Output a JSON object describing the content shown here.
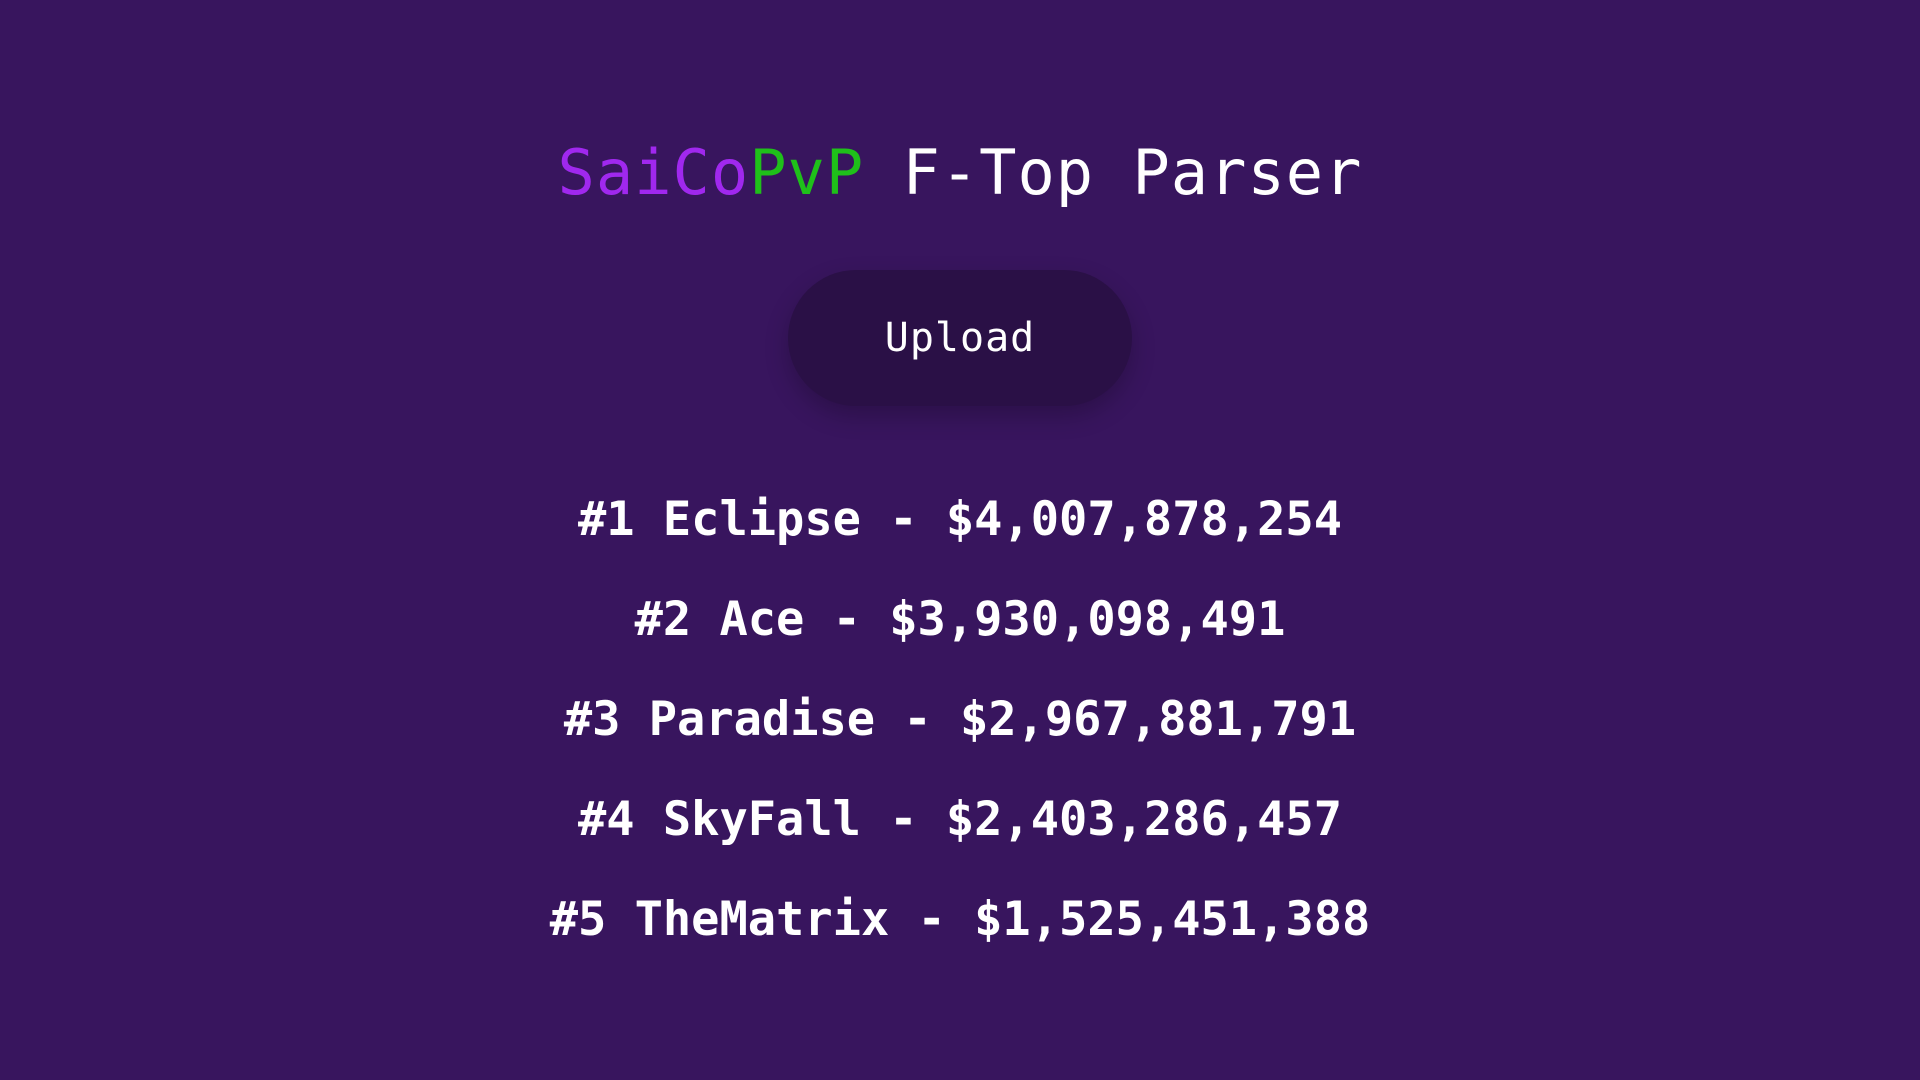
{
  "title": {
    "brand_part_1": "SaiCo",
    "brand_part_2": "PvP",
    "suffix": " F-Top Parser",
    "colors": {
      "brand_part_1": "#a028ee",
      "brand_part_2": "#1fc01a",
      "suffix": "#ffffff"
    }
  },
  "upload": {
    "label": "Upload"
  },
  "rankings": [
    "#1 Eclipse - $4,007,878,254",
    "#2 Ace - $3,930,098,491",
    "#3 Paradise - $2,967,881,791",
    "#4 SkyFall - $2,403,286,457",
    "#5 TheMatrix - $1,525,451,388"
  ],
  "colors": {
    "background": "#38155e",
    "button_background": "#2a1046",
    "text": "#ffffff"
  }
}
